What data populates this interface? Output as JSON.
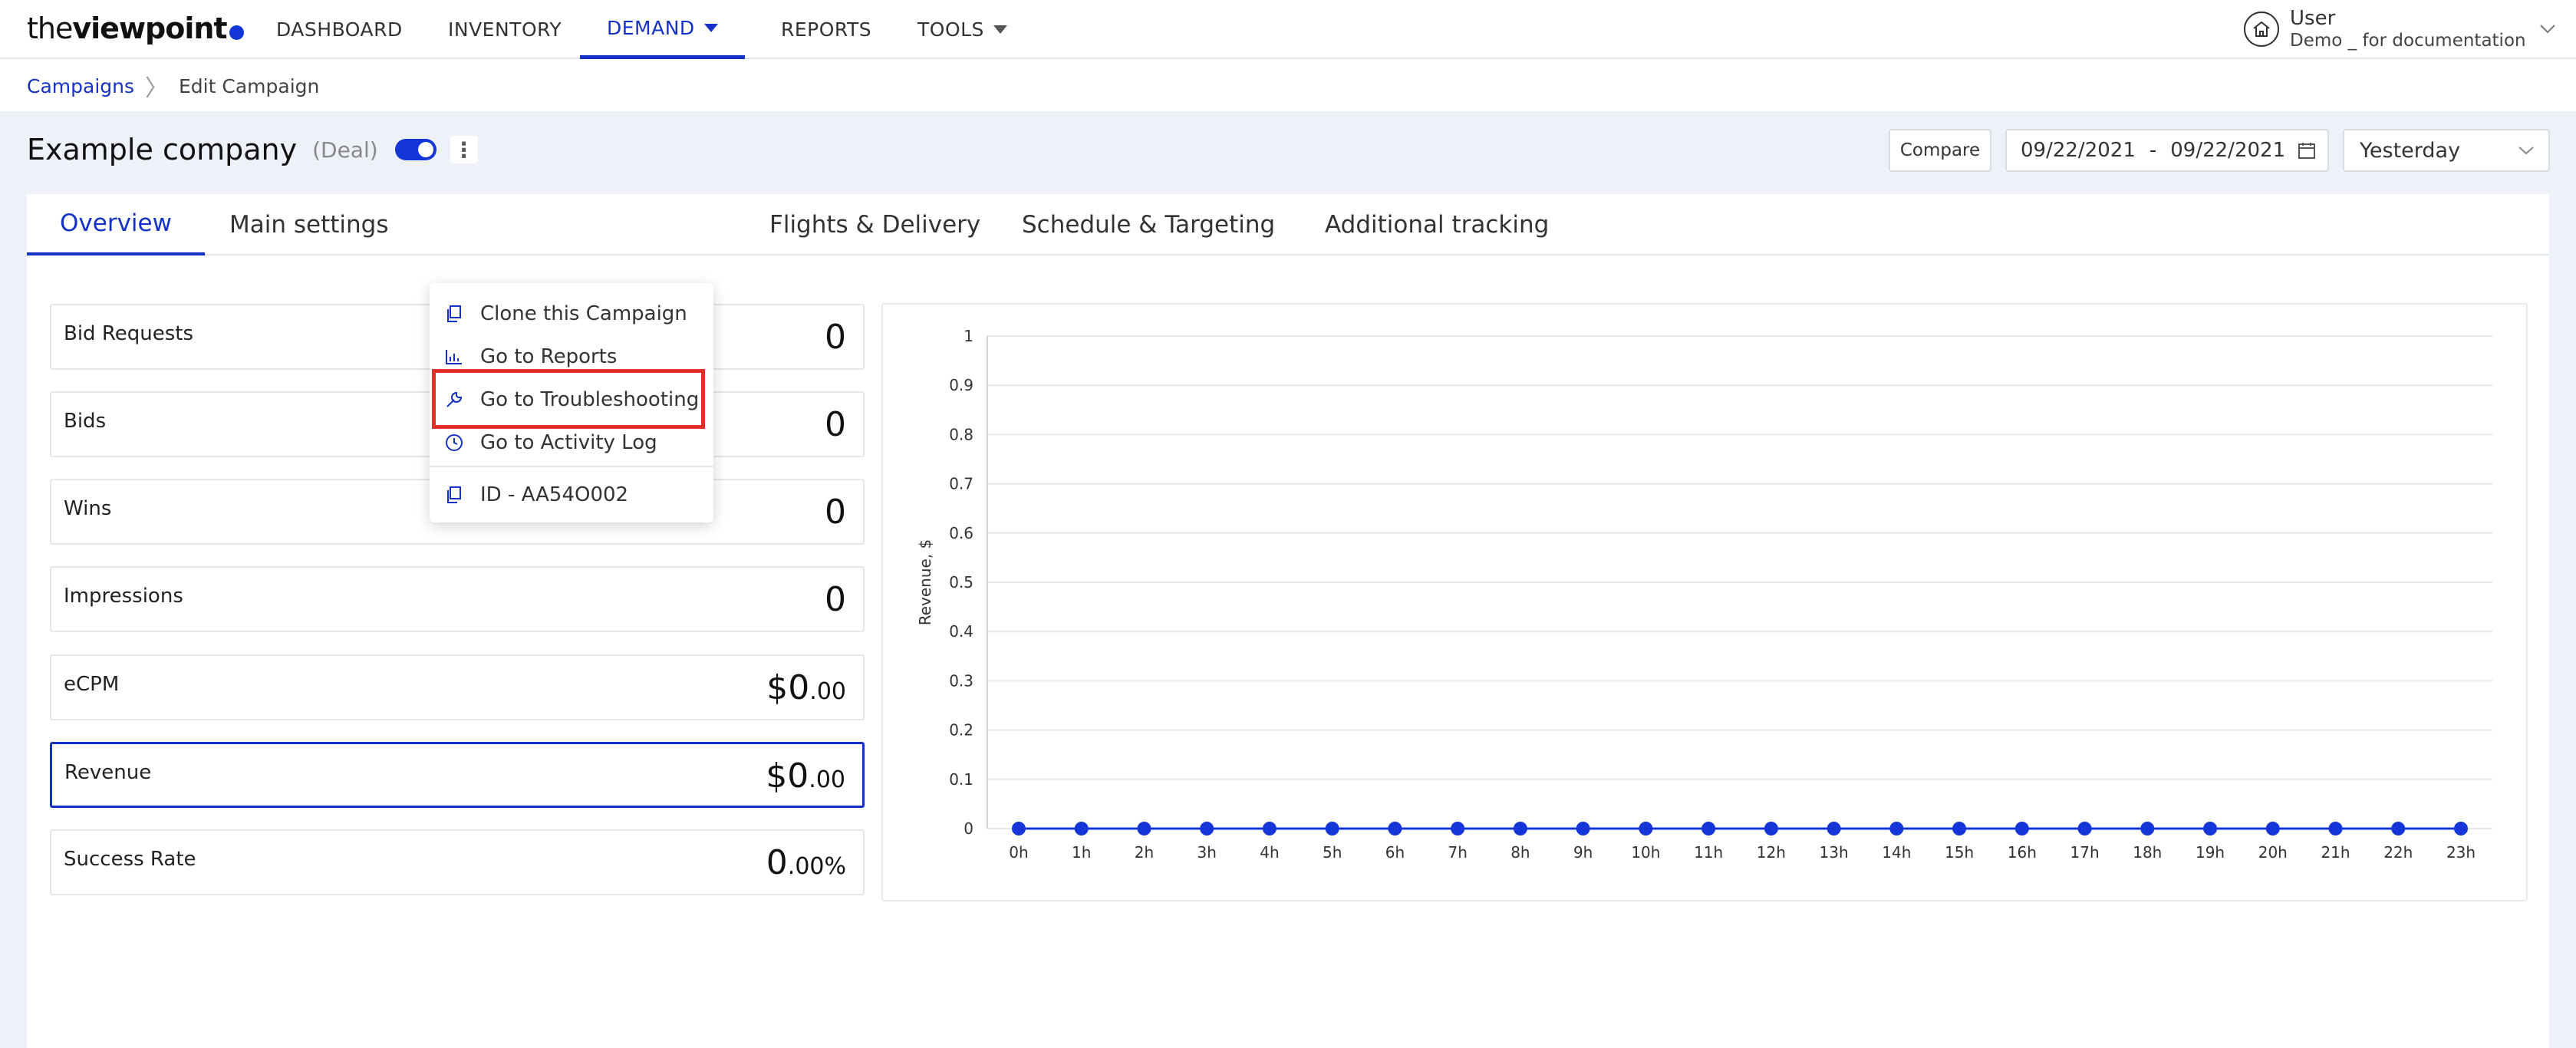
{
  "app": {
    "logo_thin": "the",
    "logo_bold": "viewpoint",
    "brand_color": "#1432c8"
  },
  "nav": {
    "items": [
      {
        "label": "DASHBOARD"
      },
      {
        "label": "INVENTORY"
      },
      {
        "label": "DEMAND"
      },
      {
        "label": "REPORTS"
      },
      {
        "label": "TOOLS"
      }
    ],
    "active": "DEMAND"
  },
  "user": {
    "name": "User",
    "subtitle": "Demo _ for documentation"
  },
  "breadcrumb": {
    "root": "Campaigns",
    "current": "Edit Campaign"
  },
  "campaign": {
    "title": "Example company",
    "type": "(Deal)",
    "enabled": true
  },
  "toolbar": {
    "compare_label": "Compare",
    "date_from": "09/22/2021",
    "date_sep": "-",
    "date_to": "09/22/2021",
    "period": "Yesterday"
  },
  "tabs": [
    {
      "label": "Overview"
    },
    {
      "label": "Main settings"
    },
    {
      "label": "Flights & Delivery"
    },
    {
      "label": "Schedule & Targeting"
    },
    {
      "label": "Additional tracking"
    }
  ],
  "menu": {
    "items": [
      {
        "label": "Clone this Campaign",
        "icon": "copy-icon"
      },
      {
        "label": "Go to Reports",
        "icon": "bar-chart-icon"
      },
      {
        "label": "Go to Troubleshooting",
        "icon": "wrench-icon"
      },
      {
        "label": "Go to Activity Log",
        "icon": "clock-icon"
      },
      {
        "label": "ID - AA54O002",
        "icon": "copy-icon"
      }
    ],
    "highlighted": "Go to Troubleshooting"
  },
  "metrics": [
    {
      "label": "Bid Requests",
      "value": "0",
      "decimals": ""
    },
    {
      "label": "Bids",
      "value": "0",
      "decimals": ""
    },
    {
      "label": "Wins",
      "value": "0",
      "decimals": ""
    },
    {
      "label": "Impressions",
      "value": "0",
      "decimals": ""
    },
    {
      "label": "eCPM",
      "value": "$0",
      "decimals": ".00"
    },
    {
      "label": "Revenue",
      "value": "$0",
      "decimals": ".00"
    },
    {
      "label": "Success Rate",
      "value": "0",
      "decimals": ".00%"
    }
  ],
  "selected_metric": "Revenue",
  "chart_data": {
    "type": "line",
    "ylabel": "Revenue, $",
    "xlabel": "",
    "ylim": [
      0,
      1
    ],
    "yticks": [
      "0",
      "0.1",
      "0.2",
      "0.3",
      "0.4",
      "0.5",
      "0.6",
      "0.7",
      "0.8",
      "0.9",
      "1"
    ],
    "categories": [
      "0h",
      "1h",
      "2h",
      "3h",
      "4h",
      "5h",
      "6h",
      "7h",
      "8h",
      "9h",
      "10h",
      "11h",
      "12h",
      "13h",
      "14h",
      "15h",
      "16h",
      "17h",
      "18h",
      "19h",
      "20h",
      "21h",
      "22h",
      "23h"
    ],
    "series": [
      {
        "values": [
          0,
          0,
          0,
          0,
          0,
          0,
          0,
          0,
          0,
          0,
          0,
          0,
          0,
          0,
          0,
          0,
          0,
          0,
          0,
          0,
          0,
          0,
          0,
          0
        ],
        "color": "#1436d8"
      }
    ],
    "grid": true
  }
}
